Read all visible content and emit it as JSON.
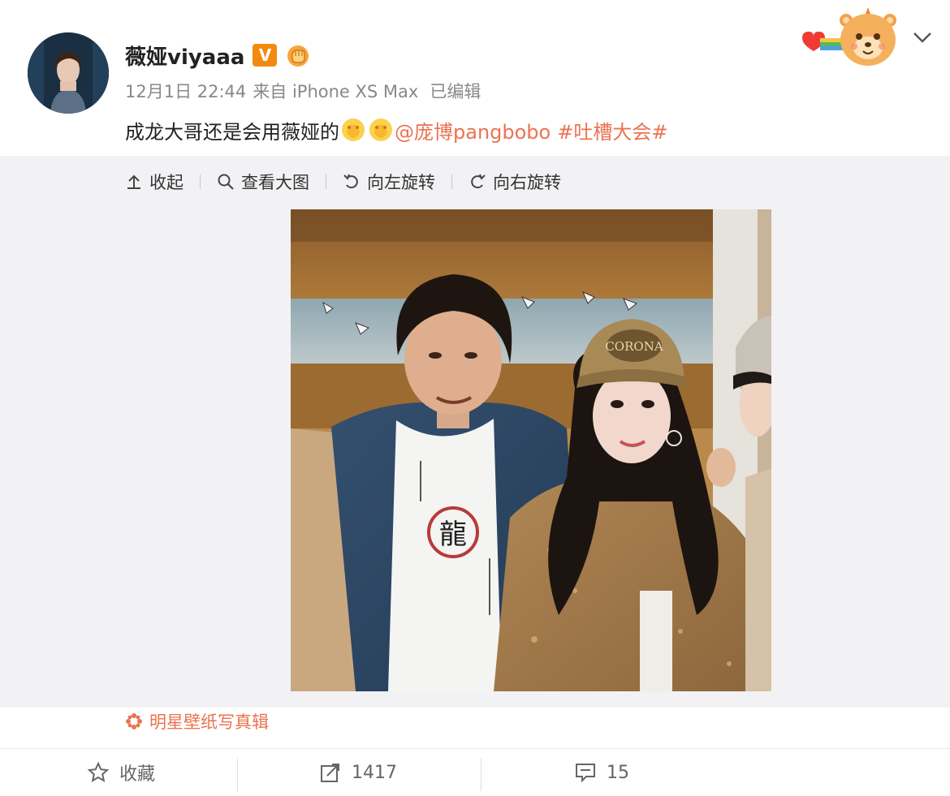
{
  "post": {
    "username": "薇娅viyaaa",
    "verified_badge": "V",
    "date": "12月1日 22:44",
    "source": "来自 iPhone XS Max",
    "edited": "已编辑",
    "text_main": "成龙大哥还是会用薇娅的",
    "mention": "@庞博pangbobo",
    "hashtag": "#吐槽大会#"
  },
  "media_toolbar": {
    "collapse_label": "收起",
    "view_large_label": "查看大图",
    "rotate_left_label": "向左旋转",
    "rotate_right_label": "向右旋转"
  },
  "photo": {
    "cap_text": "CORONA",
    "shirt_character": "龍"
  },
  "source_tag": {
    "label": "明星壁纸写真辑"
  },
  "actions": {
    "favorite_label": "收藏",
    "repost_count": "1417",
    "comment_count": "15"
  },
  "colors": {
    "accent": "#eb7350",
    "badge_orange": "#f28a10",
    "panel_bg": "#f2f2f5"
  },
  "icons": [
    "arrow-up-icon",
    "search-icon",
    "rotate-left-icon",
    "rotate-right-icon",
    "star-icon",
    "repost-icon",
    "comment-icon",
    "chevron-down-icon",
    "flower-icon"
  ]
}
